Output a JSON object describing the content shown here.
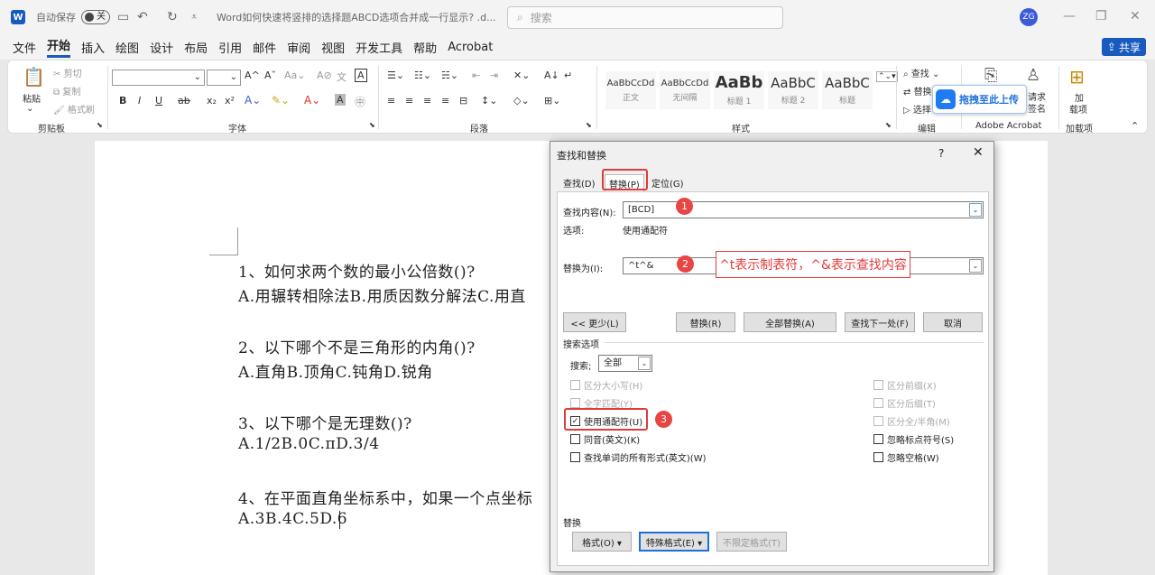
{
  "titlebar": {
    "app_icon": "W",
    "autosave_label": "自动保存",
    "autosave_state": "关",
    "doc_title": "Word如何快速将竖排的选择题ABCD选项合并成一行显示? .d...",
    "search_placeholder": "搜索",
    "avatar_initials": "ZG"
  },
  "menubar": {
    "items": [
      "文件",
      "开始",
      "插入",
      "绘图",
      "设计",
      "布局",
      "引用",
      "邮件",
      "审阅",
      "视图",
      "开发工具",
      "帮助",
      "Acrobat"
    ],
    "active": "开始",
    "share_label": "共享"
  },
  "ribbon": {
    "clipboard": {
      "paste": "粘贴",
      "cut": "剪切",
      "copy": "复制",
      "format_painter": "格式刷",
      "label": "剪贴板"
    },
    "font": {
      "bold": "B",
      "italic": "I",
      "underline": "U",
      "strike": "ab",
      "sub": "x₂",
      "sup": "x²",
      "label": "字体"
    },
    "paragraph": {
      "label": "段落"
    },
    "styles": {
      "label": "样式",
      "cards": [
        {
          "preview": "AaBbCcDd",
          "name": "正文"
        },
        {
          "preview": "AaBbCcDd",
          "name": "无间隔"
        },
        {
          "preview": "AaBb",
          "name": "标题 1"
        },
        {
          "preview": "AaBbC",
          "name": "标题 2"
        },
        {
          "preview": "AaBbC",
          "name": "标题"
        }
      ]
    },
    "editing": {
      "find": "查找",
      "replace": "替换",
      "select": "选择",
      "label": "编辑"
    },
    "acrobat": {
      "sign_label_1": "请求",
      "sign_label_2": "签名",
      "label": "Adobe Acrobat"
    },
    "addins": {
      "label_1": "加",
      "label_2": "载项",
      "label": "加载项"
    },
    "baidu_upload": "拖拽至此上传"
  },
  "document": {
    "lines": [
      "1、如何求两个数的最小公倍数()?",
      "A.用辗转相除法B.用质因数分解法C.用直",
      "2、以下哪个不是三角形的内角()?",
      "A.直角B.顶角C.钝角D.锐角",
      "3、以下哪个是无理数()?",
      "A.1/2B.0C.πD.3/4",
      "4、在平面直角坐标系中，如果一个点坐标",
      "A.3B.4C.5D.6"
    ]
  },
  "dialog": {
    "title": "查找和替换",
    "help": "?",
    "close": "✕",
    "tabs": [
      "查找(D)",
      "替换(P)",
      "定位(G)"
    ],
    "active_tab": "替换(P)",
    "find_label": "查找内容(N):",
    "find_value": "[BCD]",
    "options_label": "选项:",
    "options_value": "使用通配符",
    "replace_label": "替换为(I):",
    "replace_value": "^t^&",
    "buttons": {
      "less": "<< 更少(L)",
      "replace": "替换(R)",
      "replace_all": "全部替换(A)",
      "find_next": "查找下一处(F)",
      "cancel": "取消"
    },
    "search_options_label": "搜索选项",
    "search_label": "搜索;",
    "search_value": "全部",
    "checkboxes_left": [
      {
        "label": "区分大小写(H)",
        "checked": false,
        "enabled": false
      },
      {
        "label": "全字匹配(Y)",
        "checked": false,
        "enabled": false
      },
      {
        "label": "使用通配符(U)",
        "checked": true,
        "enabled": true
      },
      {
        "label": "同音(英文)(K)",
        "checked": false,
        "enabled": true
      },
      {
        "label": "查找单词的所有形式(英文)(W)",
        "checked": false,
        "enabled": true
      }
    ],
    "checkboxes_right": [
      {
        "label": "区分前缀(X)",
        "checked": false,
        "enabled": false
      },
      {
        "label": "区分后缀(T)",
        "checked": false,
        "enabled": false
      },
      {
        "label": "区分全/半角(M)",
        "checked": false,
        "enabled": false
      },
      {
        "label": "忽略标点符号(S)",
        "checked": false,
        "enabled": true
      },
      {
        "label": "忽略空格(W)",
        "checked": false,
        "enabled": true
      }
    ],
    "replace_section_label": "替换",
    "bottom_buttons": {
      "format": "格式(O) ▾",
      "special": "特殊格式(E) ▾",
      "no_format": "不限定格式(T)"
    }
  },
  "annotations": {
    "badge_1": "1",
    "badge_2": "2",
    "badge_3": "3",
    "note": "^t表示制表符，^&表示查找内容"
  },
  "colors": {
    "word_blue": "#185abd",
    "annotation_red": "#e23b3b"
  }
}
